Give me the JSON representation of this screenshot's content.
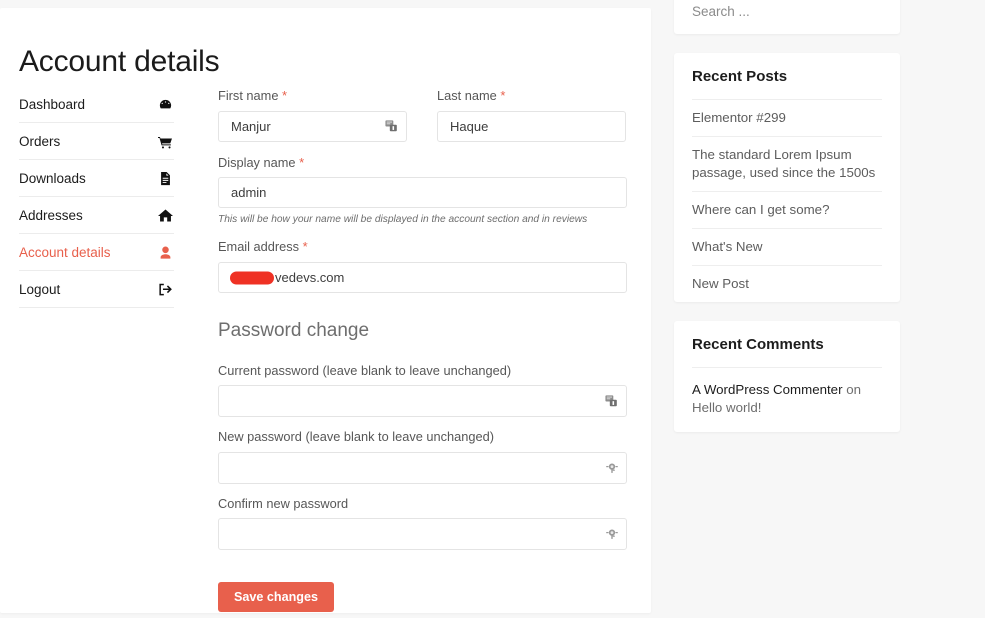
{
  "page": {
    "title": "Account details",
    "accent_color": "#e8604c",
    "background_color": "#f7f7f7",
    "card_color": "#ffffff"
  },
  "account_nav": {
    "items": [
      {
        "label": "Dashboard",
        "icon": "tachometer-icon",
        "active": false
      },
      {
        "label": "Orders",
        "icon": "shopping-cart-icon",
        "active": false
      },
      {
        "label": "Downloads",
        "icon": "file-document-icon",
        "active": false
      },
      {
        "label": "Addresses",
        "icon": "home-icon",
        "active": false
      },
      {
        "label": "Account details",
        "icon": "user-icon",
        "active": true
      },
      {
        "label": "Logout",
        "icon": "sign-out-icon",
        "active": false
      }
    ]
  },
  "form": {
    "first_name": {
      "label": "First name",
      "required_mark": "*",
      "value": "Manjur",
      "placeholder": ""
    },
    "last_name": {
      "label": "Last name",
      "required_mark": "*",
      "value": "Haque",
      "placeholder": ""
    },
    "display_name": {
      "label": "Display name",
      "required_mark": "*",
      "value": "admin",
      "placeholder": "",
      "helper": "This will be how your name will be displayed in the account section and in reviews"
    },
    "email": {
      "label": "Email address",
      "required_mark": "*",
      "value": "vedevs.com",
      "placeholder": "",
      "redacted": true,
      "redaction_color": "#ef3124"
    }
  },
  "password_change": {
    "heading": "Password change",
    "current_password": {
      "label": "Current password (leave blank to leave unchanged)",
      "value": "",
      "placeholder": ""
    },
    "new_password": {
      "label": "New password (leave blank to leave unchanged)",
      "value": "",
      "placeholder": ""
    },
    "confirm_password": {
      "label": "Confirm new password",
      "value": "",
      "placeholder": ""
    }
  },
  "actions": {
    "save_label": "Save changes"
  },
  "sidebar": {
    "search": {
      "placeholder": "Search ...",
      "value": ""
    },
    "recent_posts": {
      "title": "Recent Posts",
      "items": [
        "Elementor #299",
        "The standard Lorem Ipsum passage, used since the 1500s",
        "Where can I get some?",
        "What's New",
        "New Post"
      ]
    },
    "recent_comments": {
      "title": "Recent Comments",
      "items": [
        {
          "author": "A WordPress Commenter",
          "connector": "on",
          "post": "Hello world!"
        }
      ]
    }
  }
}
